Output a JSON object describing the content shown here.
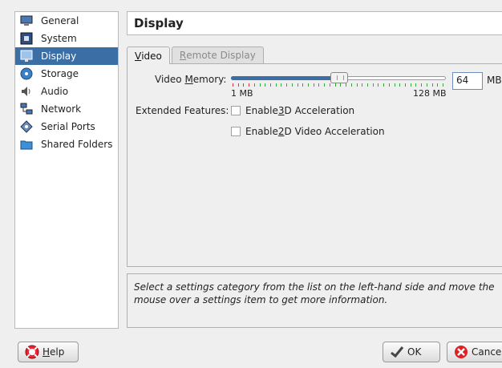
{
  "sidebar": {
    "items": [
      {
        "label": "General",
        "icon": "monitor-icon"
      },
      {
        "label": "System",
        "icon": "chip-icon"
      },
      {
        "label": "Display",
        "icon": "display-icon",
        "selected": true
      },
      {
        "label": "Storage",
        "icon": "disc-icon"
      },
      {
        "label": "Audio",
        "icon": "speaker-icon"
      },
      {
        "label": "Network",
        "icon": "network-icon"
      },
      {
        "label": "Serial Ports",
        "icon": "serial-port-icon"
      },
      {
        "label": "Shared Folders",
        "icon": "folder-icon"
      }
    ]
  },
  "header": {
    "title": "Display"
  },
  "tabs": [
    {
      "label_pre": "",
      "label_ul": "V",
      "label_post": "ideo",
      "active": true
    },
    {
      "label_pre": "",
      "label_ul": "R",
      "label_post": "emote Display",
      "active": false
    }
  ],
  "video_memory": {
    "label_pre": "Video ",
    "label_ul": "M",
    "label_post": "emory:",
    "min_label": "1 MB",
    "max_label": "128 MB",
    "value": "64",
    "unit": "MB",
    "slider_fraction": 0.5
  },
  "extended_features": {
    "label": "Extended Features:",
    "option1": {
      "pre": "Enable ",
      "ul": "3",
      "post": "D Acceleration",
      "checked": false
    },
    "option2": {
      "pre": "Enable ",
      "ul": "2",
      "post": "D Video Acceleration",
      "checked": false
    }
  },
  "info_text": "Select a settings category from the list on the left-hand side and move the mouse over a settings item to get more information.",
  "buttons": {
    "help": {
      "ul": "H",
      "post": "elp"
    },
    "ok": "OK",
    "cancel": "Cancel"
  },
  "colors": {
    "selection": "#3a6ea5",
    "tick_red": "#d33",
    "tick_green": "#3a3"
  }
}
